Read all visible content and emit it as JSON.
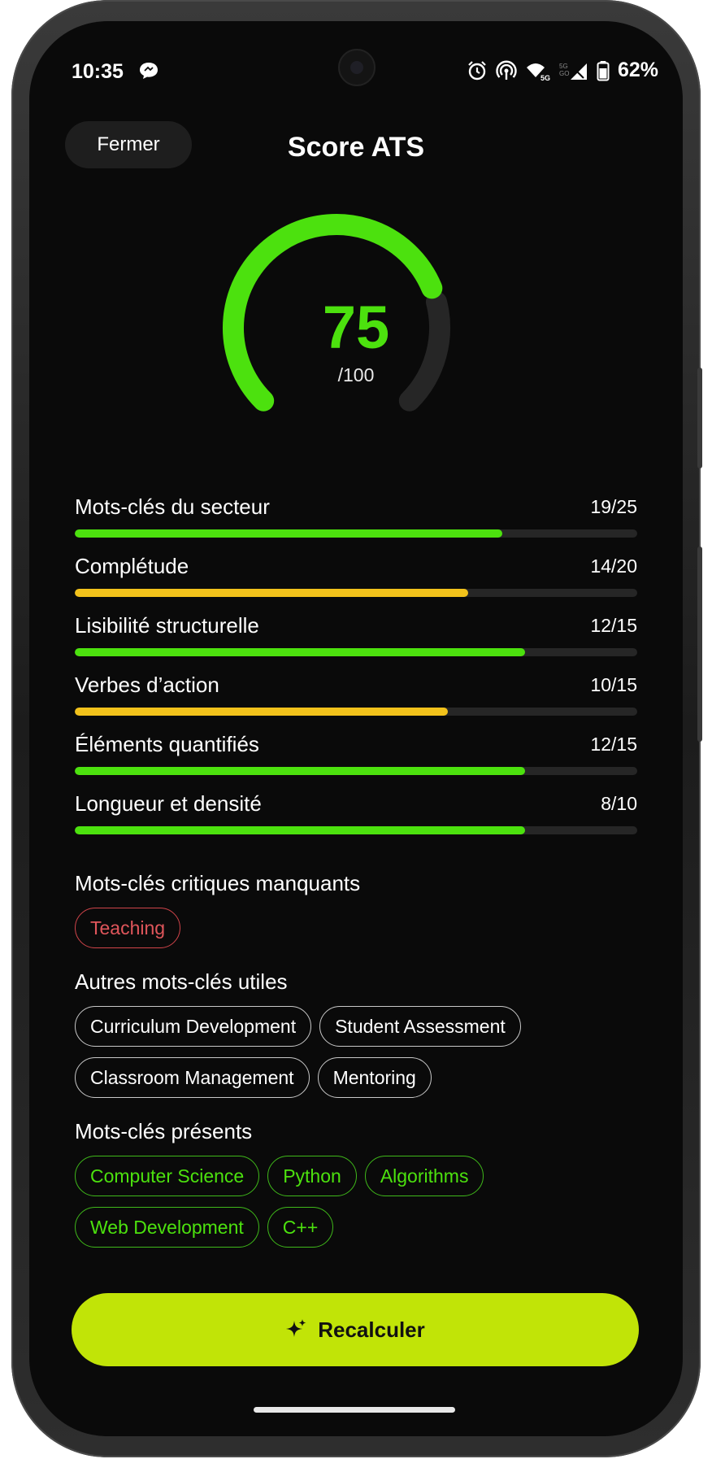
{
  "status_bar": {
    "time": "10:35",
    "battery": "62%",
    "icons": [
      "chat-bubble-icon",
      "alarm-icon",
      "hotspot-icon",
      "wifi-5g-icon",
      "signal-icon",
      "battery-icon"
    ]
  },
  "header": {
    "close_label": "Fermer",
    "title": "Score ATS"
  },
  "score": {
    "value": "75",
    "max": "/100",
    "fraction": 0.75
  },
  "criteria": [
    {
      "label": "Mots-clés du secteur",
      "score": "19/25",
      "fraction": 0.76,
      "color": "#4ce10e"
    },
    {
      "label": "Complétude",
      "score": "14/20",
      "fraction": 0.7,
      "color": "#f2c21b"
    },
    {
      "label": "Lisibilité structurelle",
      "score": "12/15",
      "fraction": 0.8,
      "color": "#4ce10e"
    },
    {
      "label": "Verbes d’action",
      "score": "10/15",
      "fraction": 0.663,
      "color": "#f2c21b"
    },
    {
      "label": "Éléments quantifiés",
      "score": "12/15",
      "fraction": 0.8,
      "color": "#4ce10e"
    },
    {
      "label": "Longueur et densité",
      "score": "8/10",
      "fraction": 0.8,
      "color": "#4ce10e"
    }
  ],
  "missing": {
    "title": "Mots-clés critiques manquants",
    "keywords": [
      "Teaching"
    ]
  },
  "useful": {
    "title": "Autres mots-clés utiles",
    "keywords": [
      "Curriculum Development",
      "Student Assessment",
      "Classroom Management",
      "Mentoring"
    ]
  },
  "present": {
    "title": "Mots-clés présents",
    "keywords": [
      "Computer Science",
      "Python",
      "Algorithms",
      "Web Development",
      "C++"
    ]
  },
  "action": {
    "recalc_label": "Recalculer",
    "icon": "sparkle-icon"
  },
  "colors": {
    "accent_green": "#4ce10e",
    "warning_yellow": "#f2c21b",
    "missing_red": "#e0565b",
    "button_lime": "#c1e407",
    "background": "#0a0a0a"
  }
}
